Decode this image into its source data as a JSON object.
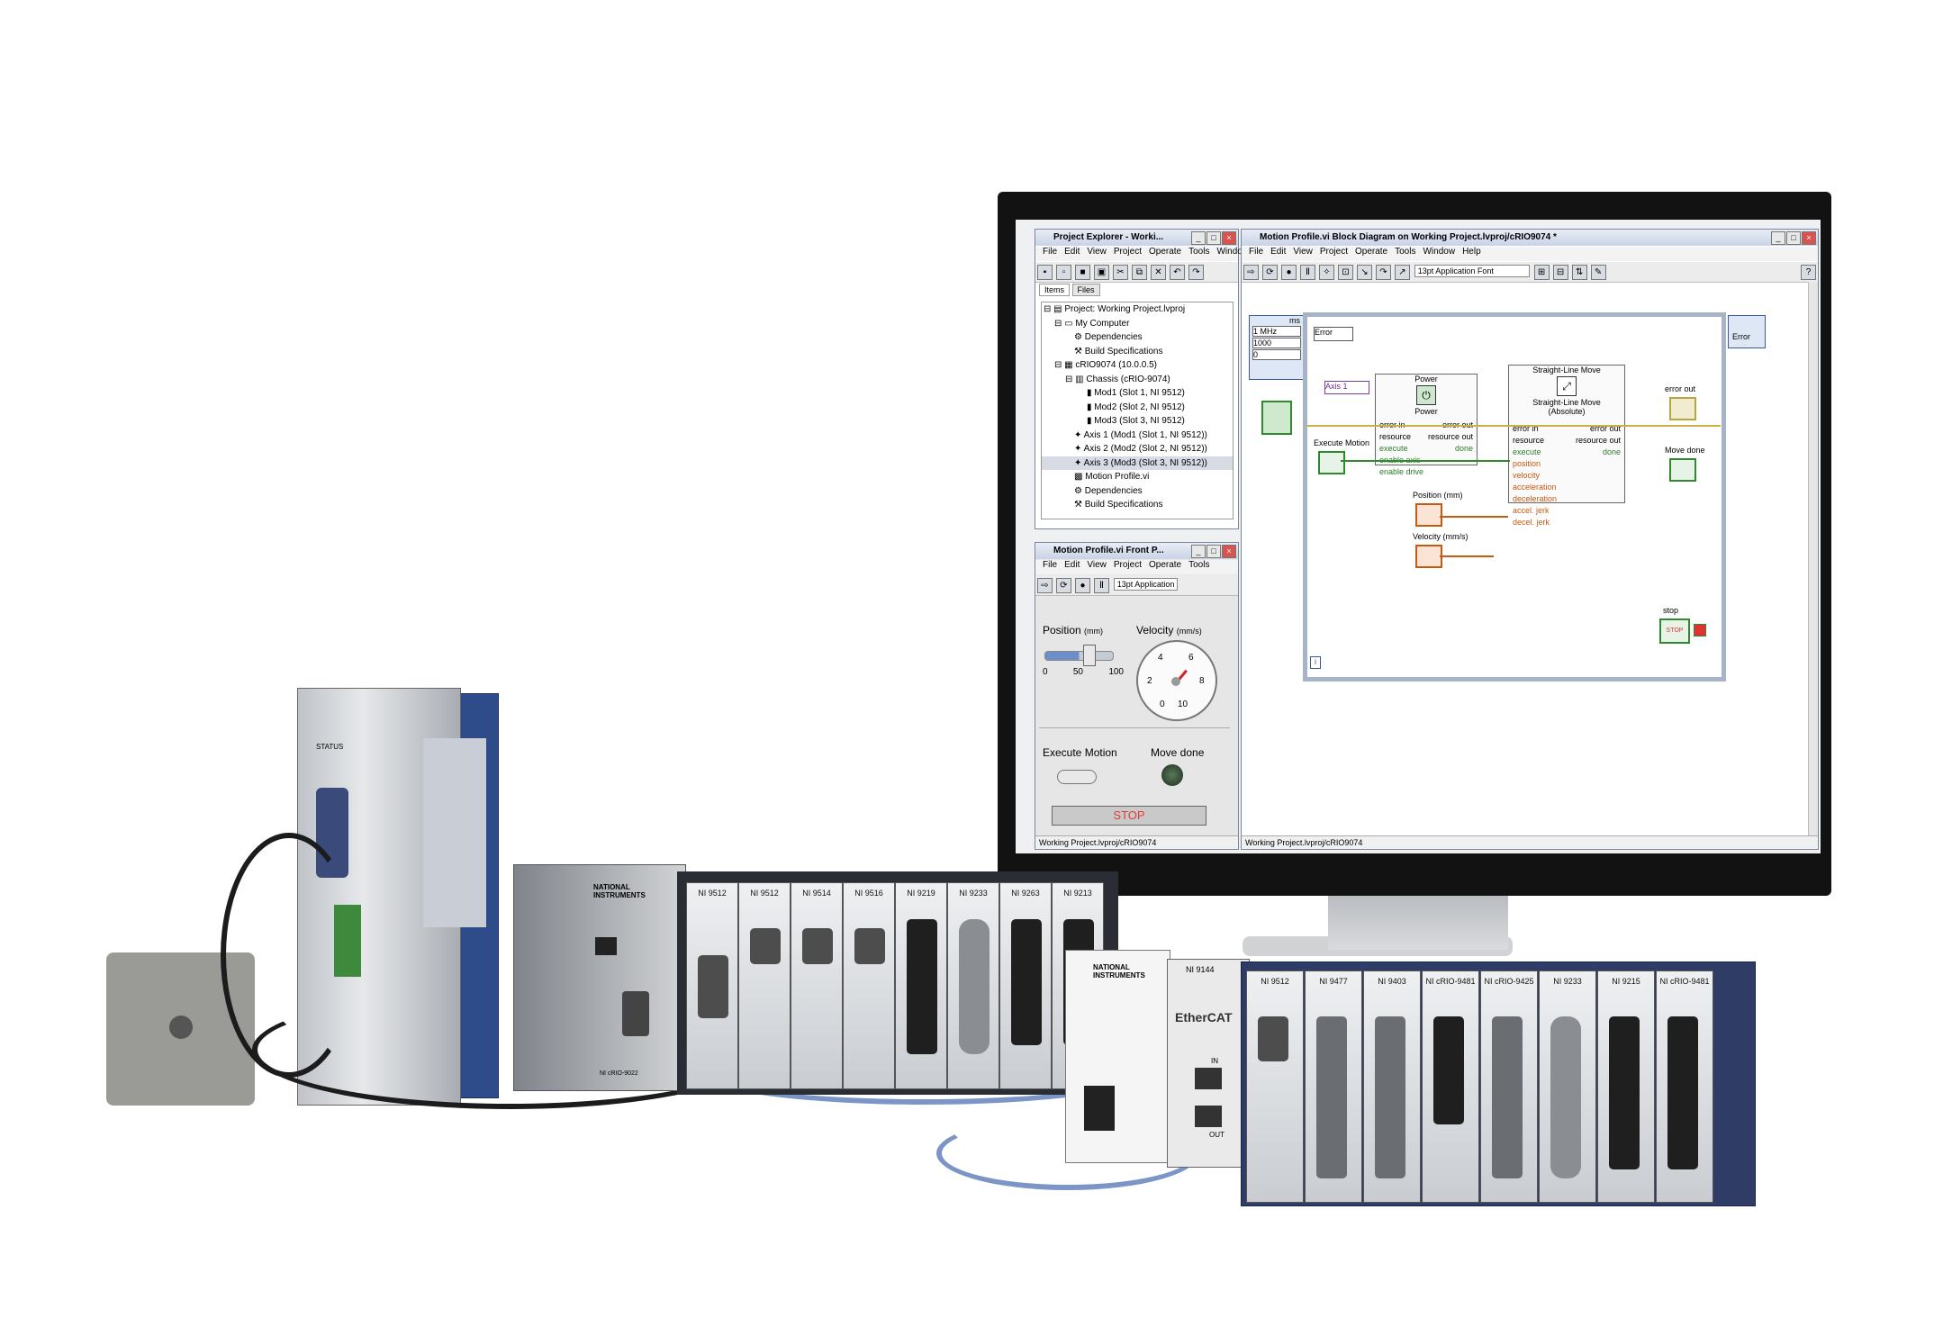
{
  "project_explorer": {
    "title": "Project Explorer - Worki...",
    "menu": [
      "File",
      "Edit",
      "View",
      "Project",
      "Operate",
      "Tools",
      "Windo"
    ],
    "tabs": [
      "Items",
      "Files"
    ],
    "tree": [
      "Project: Working Project.lvproj",
      "My Computer",
      "Dependencies",
      "Build Specifications",
      "cRIO9074 (10.0.0.5)",
      "Chassis (cRIO-9074)",
      "Mod1 (Slot 1, NI 9512)",
      "Mod2 (Slot 2, NI 9512)",
      "Mod3 (Slot 3, NI 9512)",
      "Axis 1 (Mod1 (Slot 1, NI 9512))",
      "Axis 2 (Mod2 (Slot 2, NI 9512))",
      "Axis 3 (Mod3 (Slot 3, NI 9512))",
      "Motion Profile.vi",
      "Dependencies",
      "Build Specifications"
    ]
  },
  "front_panel": {
    "title": "Motion Profile.vi Front P...",
    "menu": [
      "File",
      "Edit",
      "View",
      "Project",
      "Operate",
      "Tools"
    ],
    "font": "13pt Application",
    "position_label": "Position",
    "position_unit": "(mm)",
    "position_ticks": [
      "0",
      "50",
      "100"
    ],
    "velocity_label": "Velocity",
    "velocity_unit": "(mm/s)",
    "velocity_ticks": [
      "2",
      "4",
      "6",
      "8",
      "0",
      "10"
    ],
    "execute_label": "Execute Motion",
    "move_done_label": "Move done",
    "stop_label": "STOP",
    "status": "Working Project.lvproj/cRIO9074"
  },
  "block_diagram": {
    "title": "Motion Profile.vi Block Diagram on Working Project.lvproj/cRIO9074 *",
    "menu": [
      "File",
      "Edit",
      "View",
      "Project",
      "Operate",
      "Tools",
      "Window",
      "Help"
    ],
    "font": "13pt Application Font",
    "timing": {
      "unit": "ms",
      "rows": [
        "1 MHz",
        "1000",
        "0"
      ]
    },
    "error_in": "Error",
    "error_out": "Error",
    "axis_const": "Axis 1",
    "execute_motion": "Execute Motion",
    "power_node": {
      "title": "Power",
      "subtitle": "Power",
      "inputs": [
        "error in",
        "resource",
        "execute",
        "enable axis",
        "enable drive"
      ],
      "outputs": [
        "error out",
        "resource out",
        "done"
      ]
    },
    "move_node": {
      "title": "Straight-Line Move",
      "subtitle": "Straight-Line Move (Absolute)",
      "inputs": [
        "error in",
        "resource",
        "execute",
        "position",
        "velocity",
        "acceleration",
        "deceleration",
        "accel. jerk",
        "decel. jerk"
      ],
      "outputs": [
        "error out",
        "resource out",
        "done"
      ]
    },
    "position_ctrl": "Position (mm)",
    "velocity_ctrl": "Velocity (mm/s)",
    "error_out_ind": "error out",
    "move_done_ind": "Move done",
    "stop_ind": "stop",
    "stop_btn": "STOP",
    "loop_index": "i",
    "status": "Working Project.lvproj/cRIO9074"
  },
  "hardware": {
    "drive_status": "STATUS",
    "controller_brand": "NATIONAL INSTRUMENTS",
    "controller_model": "NI cRIO-9022",
    "chassis1_modules": [
      "NI 9512",
      "NI 9512",
      "NI 9514",
      "NI 9516",
      "NI 9219",
      "NI 9233",
      "NI 9263",
      "NI 9213"
    ],
    "ethercat_brand": "NATIONAL INSTRUMENTS",
    "ethercat_module": "NI 9144",
    "ethercat_logo": "EtherCAT",
    "ethercat_ports": [
      "IN",
      "OUT"
    ],
    "chassis2_modules": [
      "NI 9512",
      "NI 9477",
      "NI 9403",
      "NI cRIO-9481",
      "NI cRIO-9425",
      "NI 9233",
      "NI 9215",
      "NI cRIO-9481"
    ],
    "colors": {
      "chassis_blue": "#2e3c66",
      "drive_blue": "#2e4b8a",
      "ni_accent": "#1a4f9c",
      "cable_blue": "#7b95c7"
    }
  }
}
